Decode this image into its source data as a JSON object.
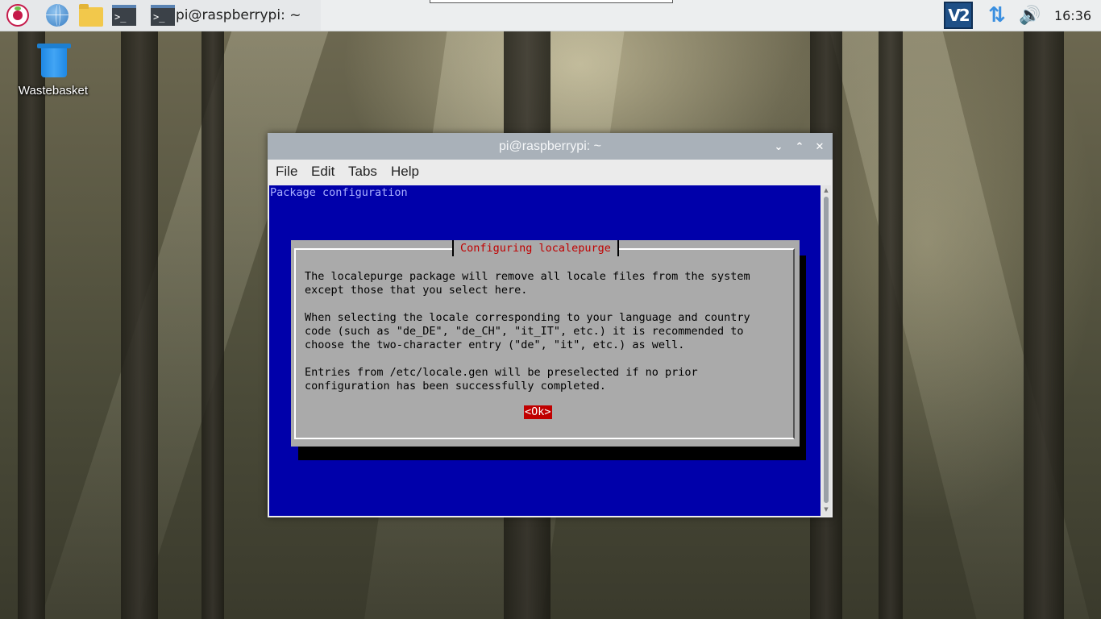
{
  "taskbar": {
    "task_label": "pi@raspberrypi: ~",
    "clock": "16:36",
    "vnc_label": "V2",
    "icons": [
      "raspberry-pi-menu-icon",
      "web-browser-icon",
      "file-manager-icon",
      "terminal-icon"
    ]
  },
  "desktop": {
    "wastebasket_label": "Wastebasket"
  },
  "window": {
    "title": "pi@raspberrypi: ~",
    "menu": {
      "file": "File",
      "edit": "Edit",
      "tabs": "Tabs",
      "help": "Help"
    }
  },
  "terminal": {
    "header": "Package configuration",
    "dialog": {
      "title": "Configuring localepurge",
      "paragraph1": "The localepurge package will remove all locale files from the system\nexcept those that you select here.",
      "paragraph2": "When selecting the locale corresponding to your language and country\ncode (such as \"de_DE\", \"de_CH\", \"it_IT\", etc.) it is recommended to\nchoose the two-character entry (\"de\", \"it\", etc.) as well.",
      "paragraph3": "Entries from /etc/locale.gen will be preselected if no prior\nconfiguration has been successfully completed.",
      "ok_label": "<Ok>"
    }
  },
  "colors": {
    "terminal_bg": "#0000aa",
    "dialog_bg": "#aaaaaa",
    "accent_red": "#c00000",
    "titlebar": "#a9b1b9"
  }
}
